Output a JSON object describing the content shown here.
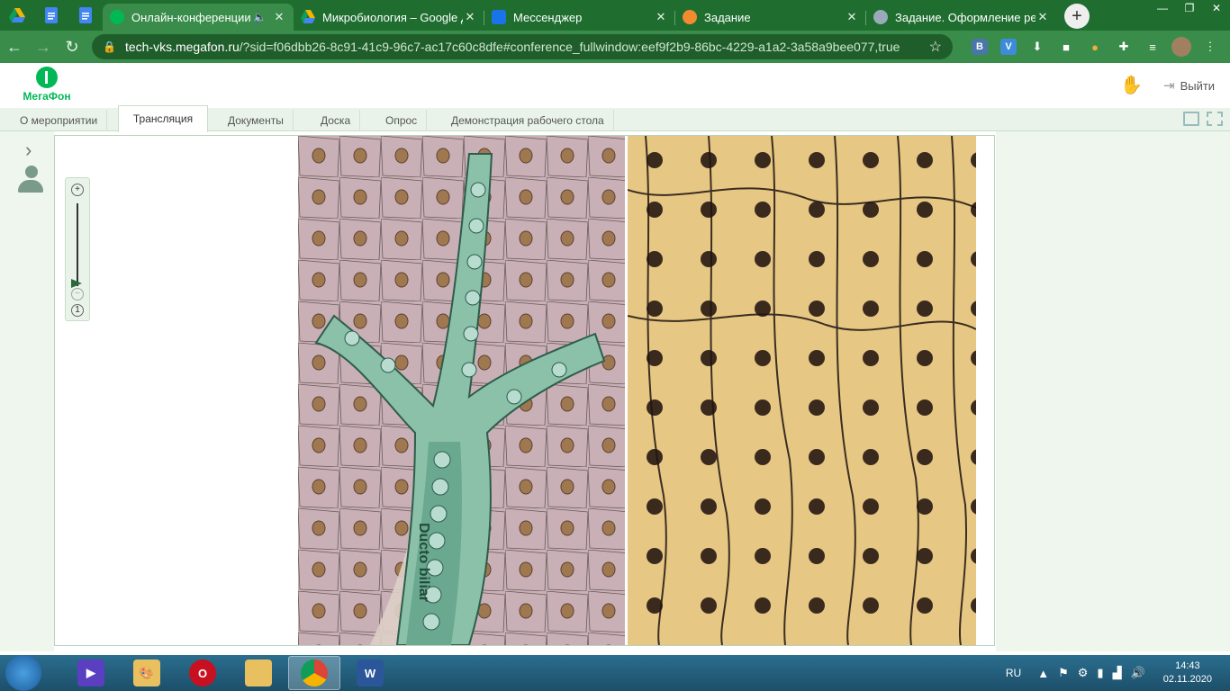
{
  "browser": {
    "tabs": [
      {
        "title": "Онлайн-конференции",
        "active": true,
        "audio": true
      },
      {
        "title": "Микробиология – Google Д",
        "active": false
      },
      {
        "title": "Мессенджер",
        "active": false
      },
      {
        "title": "Задание",
        "active": false
      },
      {
        "title": "Задание. Оформление реф",
        "active": false
      }
    ],
    "url_host": "tech-vks.megafon.ru",
    "url_rest": "/?sid=f06dbb26-8c91-41c9-96c7-ac17c60c8dfe#conference_fullwindow:eef9f2b9-86bc-4229-a1a2-3a58a9bee077,true",
    "extensions": [
      "В",
      "V"
    ]
  },
  "app": {
    "logo_text": "МегаФон",
    "exit_label": "Выйти",
    "tabs": [
      {
        "label": "О мероприятии"
      },
      {
        "label": "Трансляция"
      },
      {
        "label": "Документы"
      },
      {
        "label": "Доска"
      },
      {
        "label": "Опрос"
      },
      {
        "label": "Демонстрация рабочего стола"
      }
    ],
    "slide": {
      "duct_label": "Ducto biliar"
    },
    "zoom": {
      "plus": "+",
      "minus": "−",
      "reset": "1"
    }
  },
  "taskbar": {
    "language": "RU",
    "time": "14:43",
    "date": "02.11.2020"
  }
}
